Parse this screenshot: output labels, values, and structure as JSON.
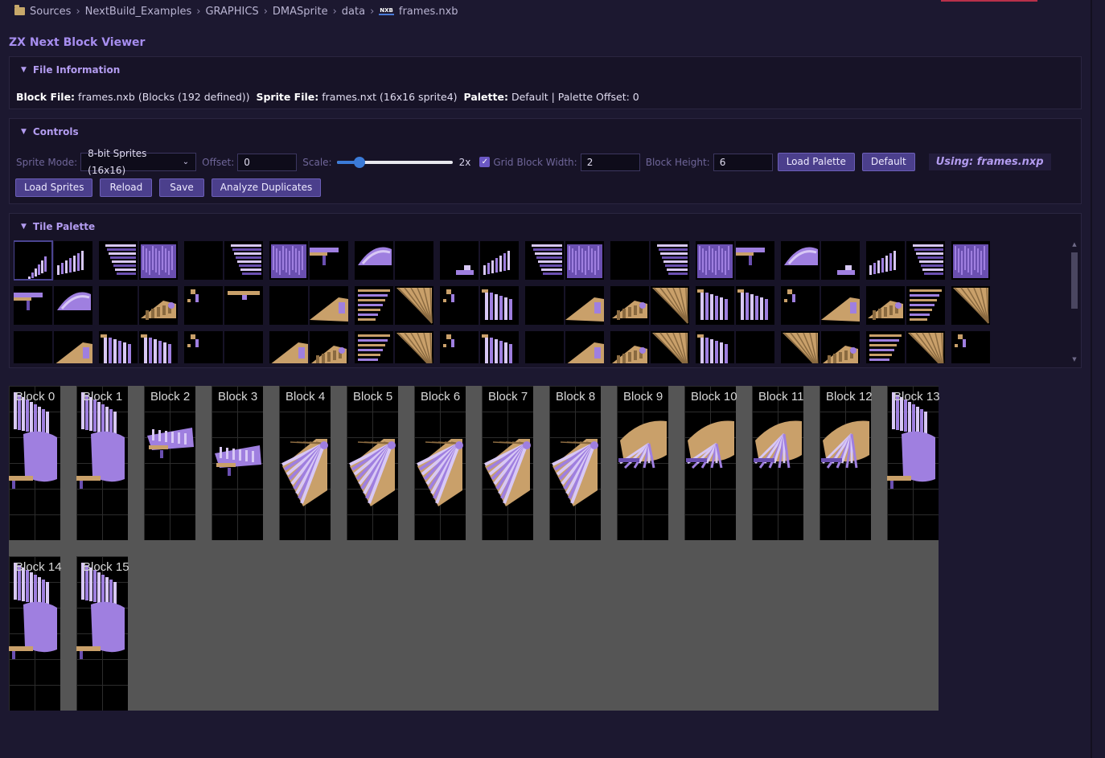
{
  "breadcrumb": {
    "items": [
      "Sources",
      "NextBuild_Examples",
      "GRAPHICS",
      "DMASprite",
      "data",
      "frames.nxb"
    ],
    "file_badge": "NXB"
  },
  "viewer": {
    "title": "ZX Next Block Viewer"
  },
  "file_info": {
    "section_title": "File Information",
    "block_file_label": "Block File:",
    "block_file_value": "frames.nxb (Blocks (192 defined))",
    "sprite_file_label": "Sprite File:",
    "sprite_file_value": "frames.nxt (16x16 sprite4)",
    "palette_label": "Palette:",
    "palette_value": "Default | Palette Offset: 0"
  },
  "controls": {
    "section_title": "Controls",
    "sprite_mode_label": "Sprite Mode:",
    "sprite_mode_value": "8-bit Sprites (16x16)",
    "offset_label": "Offset:",
    "offset_value": "0",
    "scale_label": "Scale:",
    "scale_value": "2x",
    "scale_slider_fraction": 0.2,
    "grid_label": "Grid",
    "grid_checked": true,
    "block_width_label": "Block Width:",
    "block_width_value": "2",
    "block_height_label": "Block Height:",
    "block_height_value": "6",
    "load_palette_label": "Load Palette",
    "default_label": "Default",
    "using_text": "Using: frames.nxp",
    "load_sprites_label": "Load Sprites",
    "reload_label": "Reload",
    "save_label": "Save",
    "analyze_label": "Analyze Duplicates"
  },
  "tile_palette": {
    "section_title": "Tile Palette"
  },
  "blocks": {
    "row1": [
      "Block 0",
      "Block 1",
      "Block 2",
      "Block 3",
      "Block 4",
      "Block 5",
      "Block 6",
      "Block 7",
      "Block 8",
      "Block 9",
      "Block 10",
      "Block 11",
      "Block 12",
      "Block 13"
    ],
    "row2": [
      "Block 14",
      "Block 15"
    ]
  },
  "colors": {
    "background": "#1c1830",
    "accent": "#a78ef0",
    "button": "#4b3f8c",
    "canvas": "#555555",
    "sprite_purple": "#9f7fe0",
    "sprite_tan": "#c9a06a"
  }
}
